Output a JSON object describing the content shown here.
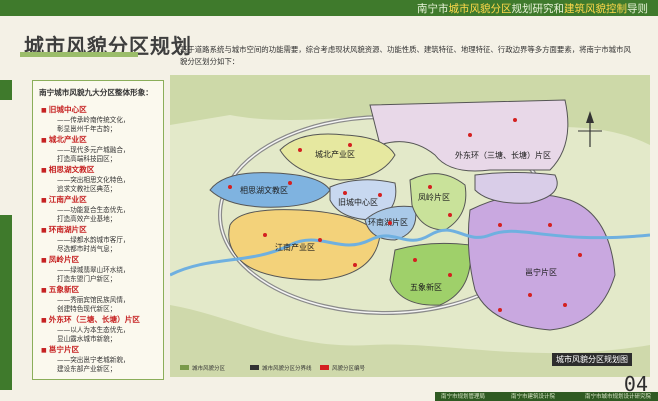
{
  "header": {
    "title_parts": [
      {
        "text": "南宁市",
        "hl": false
      },
      {
        "text": "城市风貌分区",
        "hl": true
      },
      {
        "text": "规划研究和",
        "hl": false
      },
      {
        "text": "建筑风貌控制",
        "hl": true
      },
      {
        "text": "导则",
        "hl": false
      }
    ]
  },
  "page_heading": "城市风貌分区规划",
  "intro": "基于道路系统与城市空间的功能需要，综合考虑现状风貌资源、功能性质、建筑特征、地理特征、行政边界等多方面要素，将南宁市城市风貌分区划分如下：",
  "panel": {
    "heading": "南宁城市风貌九大分区整体形象：",
    "zones": [
      {
        "name": "旧城中心区",
        "desc": [
          "——传承岭南传统文化，",
          "彰显邕州千年古韵；"
        ]
      },
      {
        "name": "城北产业区",
        "desc": [
          "——现代多元产城融合，",
          "打造高端科技园区；"
        ]
      },
      {
        "name": "相思湖文教区",
        "desc": [
          "——突出相思文化特色，",
          "追求文教社区典范；"
        ]
      },
      {
        "name": "江南产业区",
        "desc": [
          "——功能复合生态优先，",
          "打造高效产业基地；"
        ]
      },
      {
        "name": "环南湖片区",
        "desc": [
          "——绿都水韵城市客厅，",
          "尽选都市时尚气息；"
        ]
      },
      {
        "name": "凤岭片区",
        "desc": [
          "——绿城翡翠山环水绕，",
          "打造东盟门户新区；"
        ]
      },
      {
        "name": "五象新区",
        "desc": [
          "——秀丽宾馆民族风情，",
          "创建特色现代新区；"
        ]
      },
      {
        "name": "外东环（三塘、长塘）片区",
        "desc": [
          "——以人为本生态优先，",
          "显山露水城市新貌；"
        ]
      },
      {
        "name": "邕宁片区",
        "desc": [
          "——突出邕宁老城新貌，",
          "建设东部产业新区；"
        ]
      }
    ]
  },
  "map": {
    "labels": [
      {
        "id": "chengbei",
        "text": "城北产业区"
      },
      {
        "id": "xiangsihu",
        "text": "相思湖文教区"
      },
      {
        "id": "jiucheng",
        "text": "旧城中心区"
      },
      {
        "id": "huannanhu",
        "text": "环南湖片区"
      },
      {
        "id": "fengling",
        "text": "凤岭片区"
      },
      {
        "id": "jiangnan",
        "text": "江南产业区"
      },
      {
        "id": "wuxiang",
        "text": "五象新区"
      },
      {
        "id": "waidonghuan",
        "text": "外东环（三塘、长塘）片区"
      },
      {
        "id": "yongning",
        "text": "邕宁片区"
      }
    ],
    "legend": [
      {
        "text": "城市风貌分区",
        "color": "#7a9a4a"
      },
      {
        "text": "城市风貌分区分界线",
        "color": "#333333"
      },
      {
        "text": "风貌分区编号",
        "color": "#d42020"
      }
    ],
    "map_name": "城市风貌分区规划图"
  },
  "page_number": "04",
  "footer": [
    "南宁市规划管理局",
    "南宁市建筑设计院",
    "南宁市城市规划设计研究院"
  ],
  "colors": {
    "brand_green": "#3f7a2c",
    "accent_yellow": "#ffd84a",
    "zone_name_red": "#c62222"
  }
}
